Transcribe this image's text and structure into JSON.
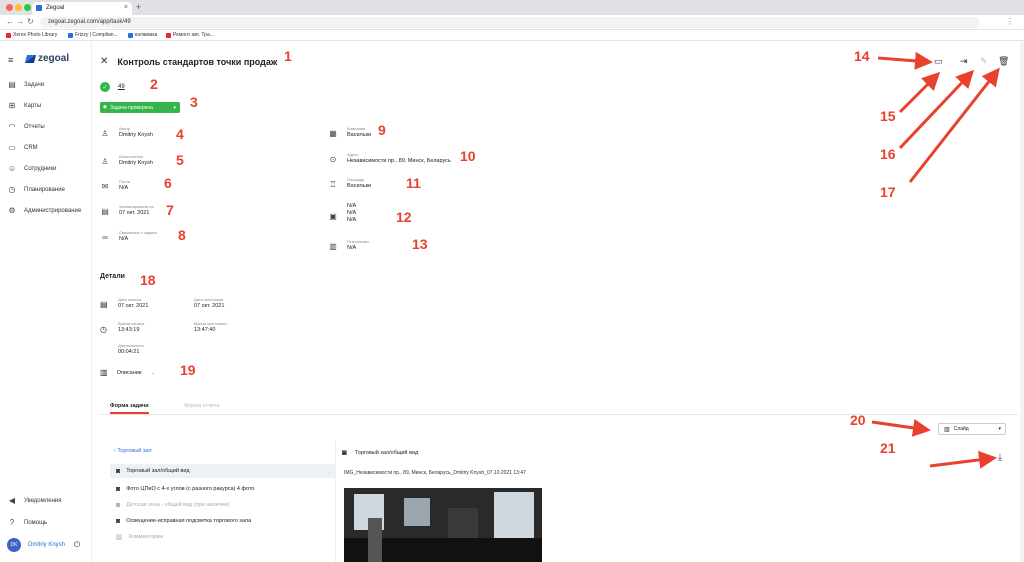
{
  "browser": {
    "tab_title": "Zegoal",
    "url": "zegoal.zegoal.com/app/task/49",
    "bookmarks": [
      "Xerox Photo Library",
      "Frizzy | Complian...",
      "взлжмака",
      "Ремонт авт. Тра..."
    ]
  },
  "sidebar": {
    "logo": "zegoal",
    "items": [
      {
        "label": "Задачи",
        "icon": "tasks-icon"
      },
      {
        "label": "Карты",
        "icon": "map-icon"
      },
      {
        "label": "Отчеты",
        "icon": "reports-icon"
      },
      {
        "label": "CRM",
        "icon": "crm-icon"
      },
      {
        "label": "Сотрудники",
        "icon": "users-icon"
      },
      {
        "label": "Планирование",
        "icon": "calendar-icon"
      },
      {
        "label": "Администрирование",
        "icon": "gear-icon"
      }
    ],
    "bottom": {
      "notifications": "Уведомления",
      "help": "Помощь",
      "user_name": "Dmitriy Knysh",
      "user_initials": "DK"
    }
  },
  "task": {
    "title": "Контроль стандартов точки продаж",
    "id": "49",
    "status": "Задача проверена",
    "fields_left": [
      {
        "label": "Автор",
        "value": "Dmitriy Knysh",
        "icon": "person-icon"
      },
      {
        "label": "Исполнитель",
        "value": "Dmitriy Knysh",
        "icon": "person-icon"
      },
      {
        "label": "Почта",
        "value": "N/A",
        "icon": "mail-icon"
      },
      {
        "label": "Запланирована на",
        "value": "07 окт. 2021",
        "icon": "calendar-icon"
      },
      {
        "label": "Связанные с задачи",
        "value": "N/A",
        "icon": "link-icon"
      }
    ],
    "fields_right": [
      {
        "label": "Компания",
        "value": "Васильки",
        "icon": "building-icon"
      },
      {
        "label": "Адрес",
        "value": "Независимости пр., 89, Минск, Беларусь",
        "icon": "location-icon"
      },
      {
        "label": "Площадь",
        "value": "Васильки",
        "icon": "place-icon"
      },
      {
        "label": "",
        "values": [
          "N/A",
          "N/A",
          "N/A"
        ],
        "icon": "image-icon"
      },
      {
        "label": "Регулятивы",
        "value": "N/A",
        "icon": "document-icon"
      }
    ]
  },
  "details": {
    "title": "Детали",
    "start_date_label": "Дата начала",
    "start_date": "07 окт. 2021",
    "end_date_label": "Дата окончания",
    "end_date": "07 окт. 2021",
    "start_time_label": "Время начала",
    "start_time": "13:43:19",
    "end_time_label": "Время окончания",
    "end_time": "13:47:40",
    "duration_label": "Длительность",
    "duration": "00:04:21",
    "description": "Описание"
  },
  "tabs": {
    "active": "Форма задачи",
    "inactive": "Форма отчета"
  },
  "view_mode": "Слайд",
  "form": {
    "back_label": "Торговый зал",
    "items": [
      {
        "label": "Торговый зал/общий вид",
        "selected": true,
        "dim": false
      },
      {
        "label": "Фото ЦПиО с 4-х углов (с разного ракурса) 4 фото",
        "selected": false,
        "dim": false
      },
      {
        "label": "Детская зона - общий вид (при наличии)",
        "selected": false,
        "dim": true
      },
      {
        "label": "Освещение-исправная подсветка торгового зала",
        "selected": false,
        "dim": false
      },
      {
        "label": "Комментарии",
        "selected": false,
        "dim": true
      }
    ],
    "view_title": "Торговый зал/общий вид",
    "image_name": "IMG_Независимости пр., 89, Минск, Беларусь_Dmitriy Knysh_07.10.2021 13:47"
  },
  "annotations": [
    "1",
    "2",
    "3",
    "4",
    "5",
    "6",
    "7",
    "8",
    "9",
    "10",
    "11",
    "12",
    "13",
    "14",
    "15",
    "16",
    "17",
    "18",
    "19",
    "20",
    "21"
  ],
  "colors": {
    "accent": "#e8412e",
    "status_green": "#35b44a",
    "link_blue": "#2d6cdf"
  }
}
